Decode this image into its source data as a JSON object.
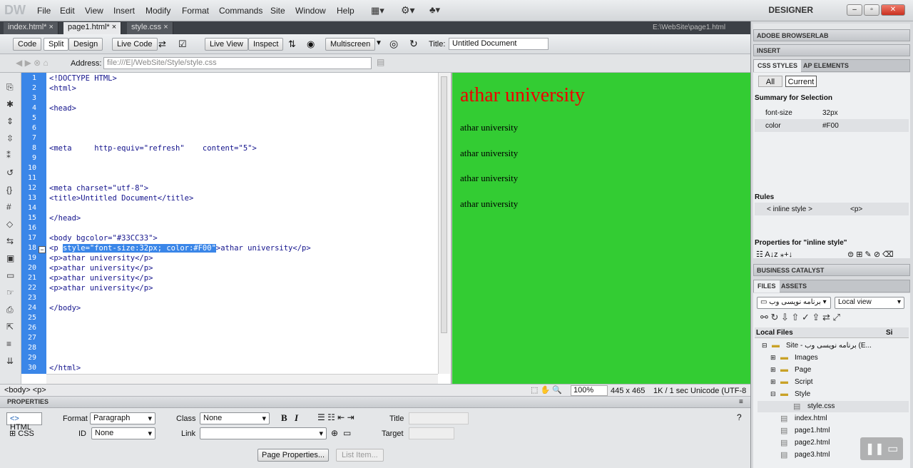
{
  "app": {
    "logo": "DW",
    "workspace": "DESIGNER"
  },
  "menu": [
    "File",
    "Edit",
    "View",
    "Insert",
    "Modify",
    "Format",
    "Commands",
    "Site",
    "Window",
    "Help"
  ],
  "tabs": [
    "index.html*",
    "page1.html*",
    "style.css"
  ],
  "doc_path": "E:\\WebSite\\page1.html",
  "toolbar": {
    "code": "Code",
    "split": "Split",
    "design": "Design",
    "live_code": "Live Code",
    "live_view": "Live View",
    "inspect": "Inspect",
    "multiscreen": "Multiscreen",
    "title_label": "Title:",
    "title_value": "Untitled Document"
  },
  "address": {
    "label": "Address:",
    "value": "file:///E|/WebSite/Style/style.css"
  },
  "code_lines": [
    "<!DOCTYPE HTML>",
    "<html>",
    "",
    "<head>",
    "",
    "",
    "",
    "<meta     http-equiv=\"refresh\"    content=\"5\">",
    "",
    "",
    "",
    "<meta charset=\"utf-8\">",
    "<title>Untitled Document</title>",
    "",
    "</head>",
    "",
    "<body bgcolor=\"#33CC33\">",
    "__SEL__",
    "<p>athar university</p>",
    "<p>athar university</p>",
    "<p>athar university</p>",
    "<p>athar university</p>",
    "",
    "</body>",
    "",
    "",
    "",
    "",
    "",
    "</html>"
  ],
  "code_line18": {
    "pre": "<p ",
    "sel": "style=\"font-size:32px; color:#F00\"",
    "post": ">athar university</p>"
  },
  "preview": {
    "heading": "athar university",
    "paras": [
      "athar university",
      "athar university",
      "athar university",
      "athar university"
    ],
    "heading_color": "#F00",
    "bg": "#33CC33"
  },
  "status": {
    "tags": "<body> <p>",
    "zoom": "100%",
    "size": "445 x 465",
    "speed": "1K / 1 sec",
    "encoding": "Unicode (UTF-8"
  },
  "properties": {
    "header": "PROPERTIES",
    "html": "HTML",
    "css": "CSS",
    "format_label": "Format",
    "format_value": "Paragraph",
    "class_label": "Class",
    "class_value": "None",
    "id_label": "ID",
    "id_value": "None",
    "link_label": "Link",
    "title_label": "Title",
    "target_label": "Target",
    "page_props": "Page Properties...",
    "list_item": "List Item..."
  },
  "panels": {
    "browserlab": "ADOBE BROWSERLAB",
    "insert": "INSERT",
    "css_styles": "CSS STYLES",
    "ap_elements": "AP ELEMENTS",
    "all": "All",
    "current": "Current",
    "summary": "Summary for Selection",
    "summary_rows": [
      {
        "prop": "font-size",
        "val": "32px"
      },
      {
        "prop": "color",
        "val": "#F00"
      }
    ],
    "rules": "Rules",
    "rule_name": "< inline style >",
    "rule_tag": "<p>",
    "props_for": "Properties for \"inline style\"",
    "business": "BUSINESS CATALYST",
    "files": "FILES",
    "assets": "ASSETS",
    "site_select": "برنامه نویسی وب",
    "view_select": "Local view",
    "local_files": "Local Files",
    "size_col": "Si",
    "tree": [
      {
        "label": "Site - برنامه نویسی وب (E...",
        "level": 0,
        "type": "site"
      },
      {
        "label": "Images",
        "level": 1,
        "type": "folder"
      },
      {
        "label": "Page",
        "level": 1,
        "type": "folder"
      },
      {
        "label": "Script",
        "level": 1,
        "type": "folder"
      },
      {
        "label": "Style",
        "level": 1,
        "type": "folder"
      },
      {
        "label": "style.css",
        "level": 2,
        "type": "file"
      },
      {
        "label": "index.html",
        "level": 1,
        "type": "file"
      },
      {
        "label": "page1.html",
        "level": 1,
        "type": "file"
      },
      {
        "label": "page2.html",
        "level": 1,
        "type": "file"
      },
      {
        "label": "page3.html",
        "level": 1,
        "type": "file"
      }
    ]
  }
}
